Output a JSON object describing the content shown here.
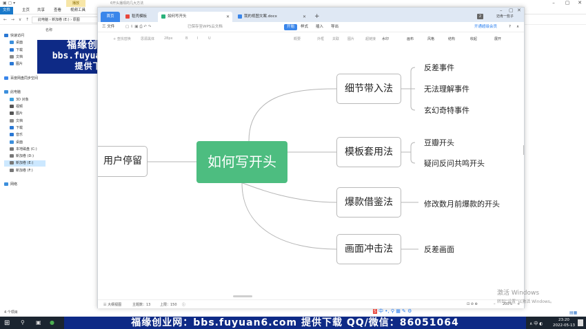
{
  "explorer": {
    "context_tab": "播放",
    "title": "6开头播现的几大方法",
    "ribbon_tabs": [
      "文件",
      "主页",
      "共享",
      "查看",
      "视频工具"
    ],
    "address_path": "此电脑 › 新加卷 (E:) › 原图",
    "column_header": "名称",
    "nav_items": [
      {
        "label": "快速访问",
        "icon": "star-icon",
        "color": "#2a78d4"
      },
      {
        "label": "桌面",
        "icon": "desktop-icon",
        "color": "#3c8fdc"
      },
      {
        "label": "下载",
        "icon": "download-icon",
        "color": "#2a78d4"
      },
      {
        "label": "文档",
        "icon": "document-icon",
        "color": "#8a8a8a"
      },
      {
        "label": "图片",
        "icon": "pictures-icon",
        "color": "#2a78d4"
      },
      {
        "label": "",
        "icon": "",
        "color": ""
      },
      {
        "label": "百度网盘同步空间",
        "icon": "cloud-icon",
        "color": "#3a86ea"
      },
      {
        "label": "",
        "icon": "",
        "color": ""
      },
      {
        "label": "此电脑",
        "icon": "computer-icon",
        "color": "#3c8fdc"
      },
      {
        "label": "3D 对象",
        "icon": "cube-icon",
        "color": "#3aa0e0"
      },
      {
        "label": "视频",
        "icon": "video-icon",
        "color": "#555555"
      },
      {
        "label": "图片",
        "icon": "pictures-icon",
        "color": "#555555"
      },
      {
        "label": "文档",
        "icon": "document-icon",
        "color": "#8a8a8a"
      },
      {
        "label": "下载",
        "icon": "download-icon",
        "color": "#2a78d4"
      },
      {
        "label": "音乐",
        "icon": "music-icon",
        "color": "#2a78d4"
      },
      {
        "label": "桌面",
        "icon": "desktop-icon",
        "color": "#3c8fdc"
      },
      {
        "label": "本地磁盘 (C:)",
        "icon": "drive-icon",
        "color": "#777777"
      },
      {
        "label": "新加卷 (D:)",
        "icon": "drive-icon",
        "color": "#777777"
      },
      {
        "label": "新加卷 (E:)",
        "icon": "drive-icon",
        "color": "#777777",
        "selected": true
      },
      {
        "label": "新加卷 (F:)",
        "icon": "drive-icon",
        "color": "#777777"
      },
      {
        "label": "",
        "icon": "",
        "color": ""
      },
      {
        "label": "网络",
        "icon": "network-icon",
        "color": "#3c8fdc"
      }
    ],
    "status": "4 个项目"
  },
  "watermark": {
    "line1": "福缘创业网",
    "line2": "bbs.fuyuan6.com",
    "line3": "提供下载"
  },
  "wps": {
    "tabs": [
      {
        "label": "首页",
        "icon": ""
      },
      {
        "label": "稻壳模板",
        "icon": "docer-icon",
        "color": "#e8473c"
      },
      {
        "label": "如何写开头",
        "icon": "mindmap-icon",
        "color": "#2ab27b"
      },
      {
        "label": "我的视图文案.docx",
        "icon": "word-icon",
        "color": "#3a86ea"
      }
    ],
    "badge": "2",
    "user": "迈肯一些子",
    "menu": {
      "file": "三 文件",
      "saved": "已保存至WPS云文档",
      "start": "开始",
      "style": "样式",
      "insert": "插入",
      "export": "导出",
      "member": "开通超级会员",
      "help": "?"
    },
    "toolbar": [
      "+ 查找替换",
      "思源黑体",
      "28px",
      "B",
      "I",
      "U",
      "概要",
      "外框",
      "关联",
      "图片",
      "超链接",
      "水印",
      "画布",
      "风格",
      "结构",
      "收起",
      "展开"
    ],
    "status": {
      "outline": "☷ 大纲视图",
      "topics": "主题数：13",
      "words": "上限：150",
      "zoom": "200%"
    }
  },
  "mindmap": {
    "root": "如何写开头",
    "left_node": "用户停留",
    "branches": [
      {
        "label": "细节带入法",
        "leaves": [
          "反差事件",
          "无法理解事件",
          "玄幻奇特事件"
        ]
      },
      {
        "label": "模板套用法",
        "leaves": [
          "豆瓣开头",
          "疑问反问共鸣开头"
        ]
      },
      {
        "label": "爆款借鉴法",
        "leaves": [
          "修改数月前爆款的开头"
        ]
      },
      {
        "label": "画面冲击法",
        "leaves": [
          "反差画面"
        ]
      }
    ],
    "line_color": "#b5b5b5",
    "root_color": "#4dbd80"
  },
  "activate": {
    "line1": "激活 Windows",
    "line2": "转到“设置”以激活 Windows。"
  },
  "taskbar": {
    "banner": "福缘创业网：bbs.fuyuan6.com  提供下载   QQ/微信：86051064",
    "time": "23:20",
    "date": "2022-05-13",
    "tray": "∧ 中 ◐"
  }
}
